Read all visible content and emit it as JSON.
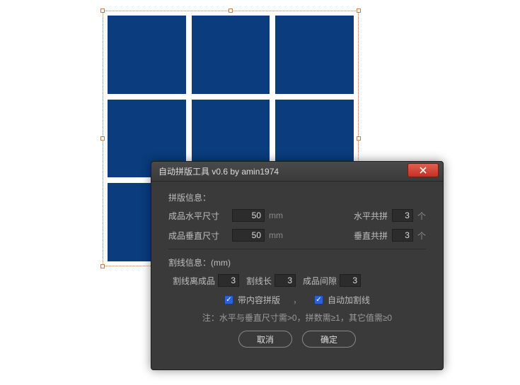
{
  "dialog": {
    "title": "自动拼版工具 v0.6   by amin1974",
    "section1_label": "拼版信息：",
    "h_size_label": "成品水平尺寸",
    "h_size_value": "50",
    "h_size_unit": "mm",
    "h_count_label": "水平共拼",
    "h_count_value": "3",
    "h_count_unit": "个",
    "v_size_label": "成品垂直尺寸",
    "v_size_value": "50",
    "v_size_unit": "mm",
    "v_count_label": "垂直共拼",
    "v_count_value": "3",
    "v_count_unit": "个",
    "section2_label": "割线信息：(mm)",
    "cut_offset_label": "割线离成品",
    "cut_offset_value": "3",
    "cut_len_label": "割线长",
    "cut_len_value": "3",
    "gap_label": "成品间隙",
    "gap_value": "3",
    "cb1_label": "带内容拼版",
    "cb2_label": "自动加割线",
    "sep": "，",
    "note": "注：水平与垂直尺寸需>0，拼数需≥1，其它值需≥0",
    "cancel": "取消",
    "ok": "确定"
  }
}
